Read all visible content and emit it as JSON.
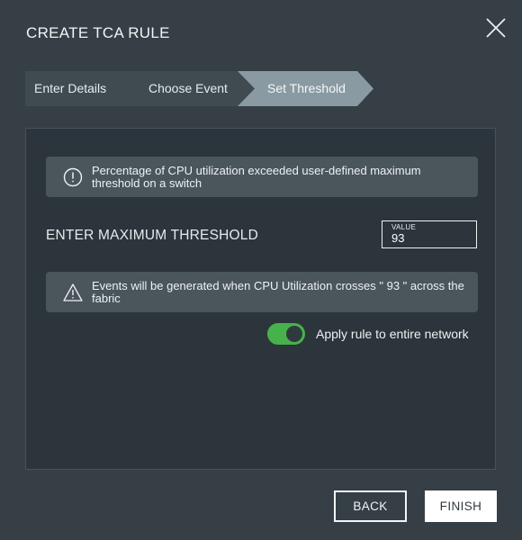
{
  "dialog": {
    "title": "CREATE TCA RULE",
    "close_icon": "close-icon"
  },
  "steps": [
    {
      "label": "Enter Details",
      "state": "done"
    },
    {
      "label": "Choose Event",
      "state": "done"
    },
    {
      "label": "Set Threshold",
      "state": "active"
    }
  ],
  "info_banner": {
    "icon": "info-circle-icon",
    "text": "Percentage of CPU utilization exceeded user-defined maximum threshold on a switch"
  },
  "threshold": {
    "label": "ENTER MAXIMUM THRESHOLD",
    "input_label": "VALUE",
    "input_value": "93"
  },
  "warning_banner": {
    "icon": "warning-triangle-icon",
    "text": "Events will be generated when CPU Utilization crosses \" 93 \" across the fabric"
  },
  "network_toggle": {
    "label": "Apply rule to entire network",
    "on": true
  },
  "footer": {
    "back_label": "BACK",
    "finish_label": "FINISH"
  },
  "colors": {
    "background": "#353f45",
    "panel": "#2b353b",
    "step_active": "#8a9aa2",
    "step_inactive": "#404b51",
    "toggle_on": "#47b14b"
  }
}
